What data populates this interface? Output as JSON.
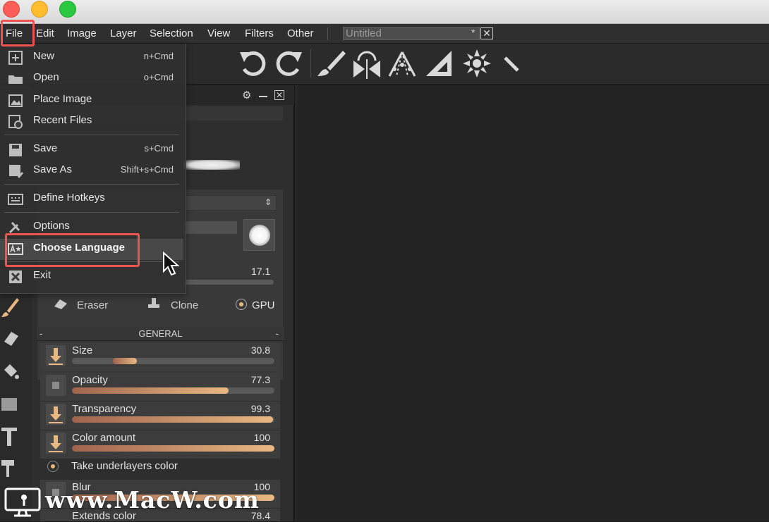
{
  "menubar": {
    "items": [
      "File",
      "Edit",
      "Image",
      "Layer",
      "Selection",
      "View",
      "Filters",
      "Other"
    ],
    "document_title": "Untitled",
    "document_modified": "*",
    "close_glyph": "✕"
  },
  "file_menu": {
    "items": [
      {
        "label": "New",
        "shortcut": "n+Cmd",
        "icon": "new-document-icon"
      },
      {
        "label": "Open",
        "shortcut": "o+Cmd",
        "icon": "folder-icon"
      },
      {
        "label": "Place Image",
        "shortcut": "",
        "icon": "image-icon"
      },
      {
        "label": "Recent Files",
        "shortcut": "",
        "icon": "recent-files-icon"
      },
      {
        "label": "Save",
        "shortcut": "s+Cmd",
        "icon": "save-icon"
      },
      {
        "label": "Save As",
        "shortcut": "Shift+s+Cmd",
        "icon": "save-as-icon"
      },
      {
        "label": "Define Hotkeys",
        "shortcut": "",
        "icon": "keyboard-icon"
      },
      {
        "label": "Options",
        "shortcut": "",
        "icon": "wrench-icon"
      },
      {
        "label": "Choose Language",
        "shortcut": "",
        "icon": "language-icon"
      },
      {
        "label": "Exit",
        "shortcut": "",
        "icon": "exit-icon"
      }
    ]
  },
  "brush_panel": {
    "size_readout": "17.1",
    "tools": {
      "eraser": "Eraser",
      "clone": "Clone",
      "gpu": "GPU"
    },
    "general_header": "GENERAL",
    "dash": "-",
    "sliders": [
      {
        "label": "Size",
        "value": "30.8"
      },
      {
        "label": "Opacity",
        "value": "77.3"
      },
      {
        "label": "Transparency",
        "value": "99.3"
      },
      {
        "label": "Color amount",
        "value": "100"
      }
    ],
    "take_underlayers": "Take underlayers color",
    "blur": {
      "label": "Blur",
      "value": "100"
    },
    "extends_color": {
      "label": "Extends color",
      "value": "78.4"
    }
  },
  "watermark": "www.MacW.com",
  "colors": {
    "accent_red": "#ef5450",
    "slider_start": "#a0644e",
    "slider_end": "#e8b882"
  }
}
